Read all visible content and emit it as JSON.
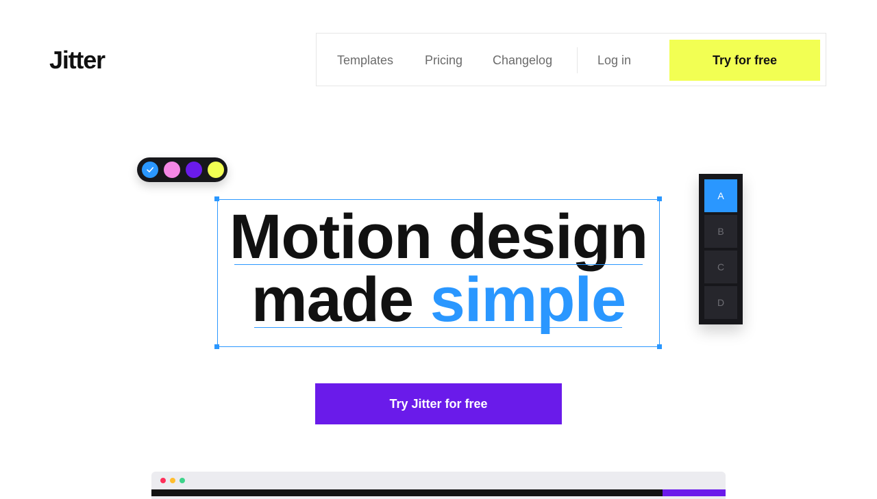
{
  "brand": {
    "logo": "Jitter"
  },
  "nav": {
    "links": [
      {
        "label": "Templates"
      },
      {
        "label": "Pricing"
      },
      {
        "label": "Changelog"
      }
    ],
    "login_label": "Log in",
    "cta_label": "Try for free"
  },
  "swatches": [
    {
      "name": "blue",
      "color": "#2a97ff",
      "selected": true,
      "icon": "check-icon"
    },
    {
      "name": "pink",
      "color": "#f587e5",
      "selected": false
    },
    {
      "name": "purple",
      "color": "#6a1bea",
      "selected": false
    },
    {
      "name": "yellow",
      "color": "#f2ff53",
      "selected": false
    }
  ],
  "hero": {
    "line1": "Motion design",
    "line2_plain": "made",
    "line2_accent": "simple",
    "accent_color": "#2a97ff"
  },
  "letter_panel": {
    "items": [
      "A",
      "B",
      "C",
      "D"
    ],
    "active": "A"
  },
  "cta": {
    "label": "Try Jitter for free"
  },
  "colors": {
    "nav_cta_bg": "#f2ff53",
    "main_cta_bg": "#6a1bea",
    "selection": "#2a97ff",
    "dark_panel": "#17171b"
  }
}
